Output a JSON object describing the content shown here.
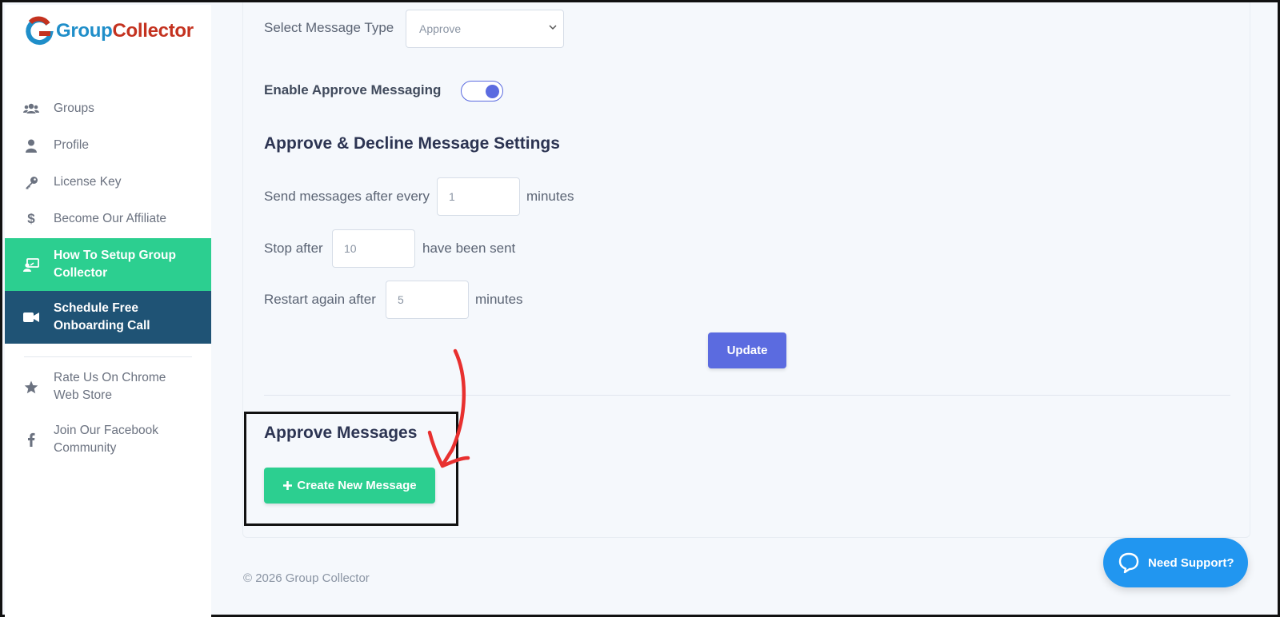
{
  "brand": {
    "part1": "Group",
    "part2": "Collector"
  },
  "sidebar": {
    "items": [
      {
        "label": "Groups",
        "icon": "users-icon"
      },
      {
        "label": "Profile",
        "icon": "user-icon"
      },
      {
        "label": "License Key",
        "icon": "key-icon"
      },
      {
        "label": "Become Our Affiliate",
        "icon": "dollar-icon"
      },
      {
        "label": "How To Setup Group Collector",
        "icon": "teacher-icon"
      },
      {
        "label": "Schedule Free Onboarding Call",
        "icon": "video-icon"
      },
      {
        "label": "Rate Us On Chrome Web Store",
        "icon": "star-icon"
      },
      {
        "label": "Join Our Facebook Community",
        "icon": "facebook-icon"
      }
    ]
  },
  "form": {
    "message_type_label": "Select Message Type",
    "message_type_value": "Approve",
    "enable_label": "Enable Approve Messaging",
    "enable_on": true,
    "settings_heading": "Approve & Decline Message Settings",
    "send_prefix": "Send messages after every",
    "send_value": "1",
    "send_suffix": "minutes",
    "stop_prefix": "Stop after",
    "stop_value": "10",
    "stop_suffix": "have been sent",
    "restart_prefix": "Restart again after",
    "restart_value": "5",
    "restart_suffix": "minutes",
    "update_label": "Update",
    "messages_heading": "Approve Messages",
    "create_label": "Create New Message"
  },
  "footer": {
    "text": "© 2026 Group Collector"
  },
  "support": {
    "label": "Need Support?"
  },
  "colors": {
    "green": "#2ccf90",
    "dark_blue": "#1f5375",
    "accent": "#5b6be0",
    "support_blue": "#2196f0",
    "annotation_red": "#e8302f"
  }
}
